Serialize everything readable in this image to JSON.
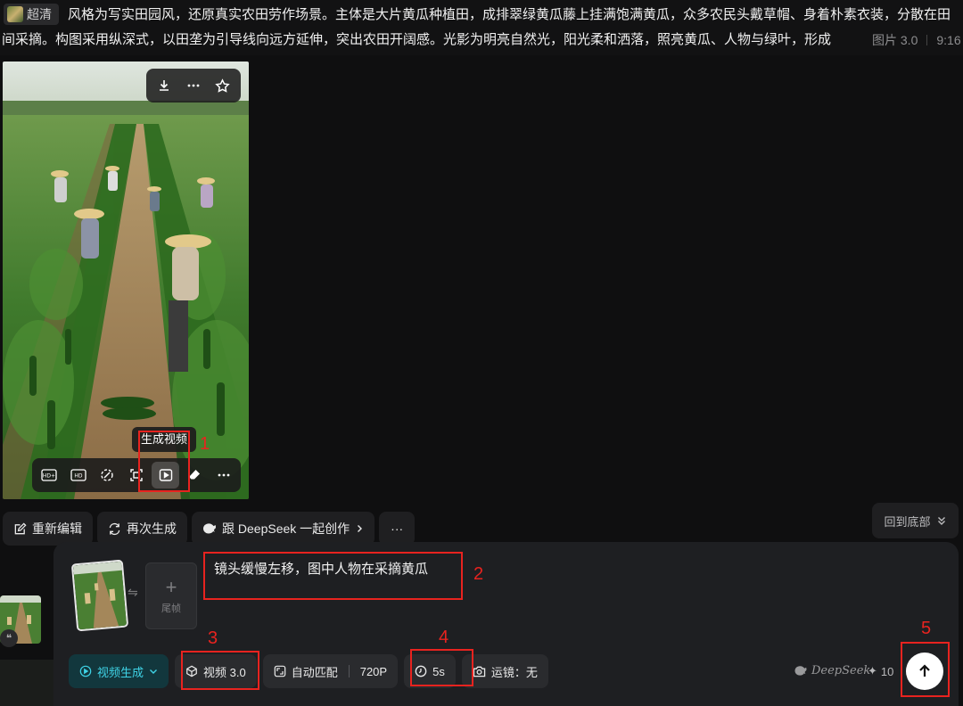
{
  "top": {
    "quality_badge": "超清",
    "prompt_line1": "风格为写实田园风，还原真实农田劳作场景。主体是大片黄瓜种植田，成排翠绿黄瓜藤上挂满饱满黄瓜，众多农民头戴草帽、身着朴素衣装，分散在田",
    "prompt_line2": "间采摘。构图采用纵深式，以田垄为引导线向远方延伸，突出农田开阔感。光影为明亮自然光，阳光柔和洒落，照亮黄瓜、人物与绿叶，形成",
    "model_tag": "图片 3.0",
    "time": "9:16"
  },
  "image_tooltip": "生成视频",
  "image_actions": [
    "download-icon",
    "more-icon",
    "star-icon"
  ],
  "image_tools": [
    "hd-plus-icon",
    "hd-icon",
    "repaint-icon",
    "expand-icon",
    "play-video-icon",
    "eraser-icon",
    "more-icon"
  ],
  "actions": {
    "re_edit": "重新编辑",
    "regenerate": "再次生成",
    "deepseek": "跟 DeepSeek 一起创作",
    "more": "···"
  },
  "back_to_bottom": "回到底部",
  "composer": {
    "last_frame_label": "尾帧",
    "prompt": "镜头缓慢左移，图中人物在采摘黄瓜",
    "mode": "视频生成",
    "model": "视频 3.0",
    "ratio": "自动匹配",
    "resolution": "720P",
    "duration": "5s",
    "camera": "运镜：无",
    "deepseek_brand": "DeepSeek",
    "credits": "10"
  },
  "annotations": [
    "1",
    "2",
    "3",
    "4",
    "5"
  ],
  "colors": {
    "annotation": "#e8231f",
    "mode_accent": "#3fd3e6",
    "background": "#0f0f10"
  }
}
